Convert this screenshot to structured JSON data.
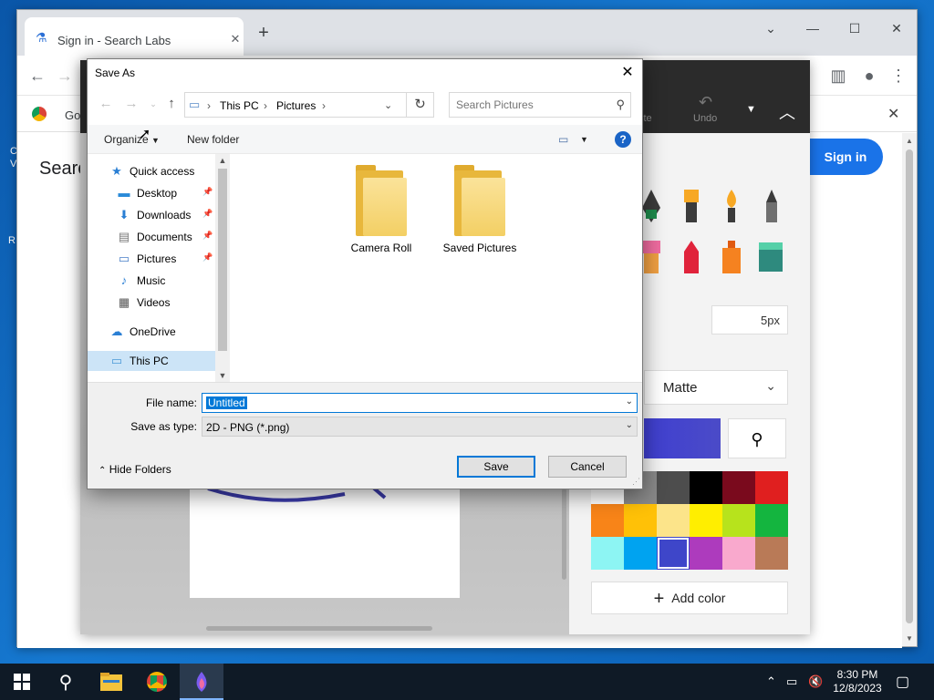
{
  "desktop": {
    "frag1": "C",
    "frag2": "V",
    "frag3": "R"
  },
  "chrome": {
    "tab_title": "Sign in - Search Labs",
    "tab_close": "✕",
    "new_tab": "+",
    "minimize": "⌄",
    "restore": "☐",
    "close": "✕",
    "bookmark_fragment": "Go",
    "page_heading_fragment": "Searc",
    "sign_in": "Sign in"
  },
  "paint": {
    "ribbon_paste": "ste",
    "ribbon_undo": "Undo",
    "size_value": "5px",
    "texture": "Matte",
    "add_color": "Add color",
    "palette": [
      "#ffffff",
      "#888888",
      "#4d4d4d",
      "#000000",
      "#7a0a1d",
      "#e01f1f",
      "#f88418",
      "#ffc107",
      "#fce48a",
      "#ffee00",
      "#b7e31c",
      "#14b53f",
      "#8df5f3",
      "#00a3f0",
      "#3e46c9",
      "#ad3bbd",
      "#f9a9cd",
      "#b97a57"
    ],
    "selected_swatch_index": 14
  },
  "dialog": {
    "title": "Save As",
    "close": "✕",
    "address": {
      "root": "This PC",
      "folder": "Pictures"
    },
    "search_placeholder": "Search Pictures",
    "organize": "Organize",
    "new_folder": "New folder",
    "help": "?",
    "nav": [
      {
        "label": "Quick access",
        "icon": "star-icon"
      },
      {
        "label": "Desktop",
        "icon": "desktop-icon",
        "pinned": true
      },
      {
        "label": "Downloads",
        "icon": "download-icon",
        "pinned": true
      },
      {
        "label": "Documents",
        "icon": "documents-icon",
        "pinned": true
      },
      {
        "label": "Pictures",
        "icon": "pictures-icon",
        "pinned": true
      },
      {
        "label": "Music",
        "icon": "music-icon"
      },
      {
        "label": "Videos",
        "icon": "videos-icon"
      },
      {
        "label": "OneDrive",
        "icon": "cloud-icon"
      },
      {
        "label": "This PC",
        "icon": "computer-icon",
        "selected": true
      }
    ],
    "folders": [
      "Camera Roll",
      "Saved Pictures"
    ],
    "file_name_label": "File name:",
    "file_name_value": "Untitled",
    "save_type_label": "Save as type:",
    "save_type_value": "2D - PNG (*.png)",
    "hide_folders": "Hide Folders",
    "save": "Save",
    "cancel": "Cancel"
  },
  "taskbar": {
    "time": "8:30 PM",
    "date": "12/8/2023"
  }
}
